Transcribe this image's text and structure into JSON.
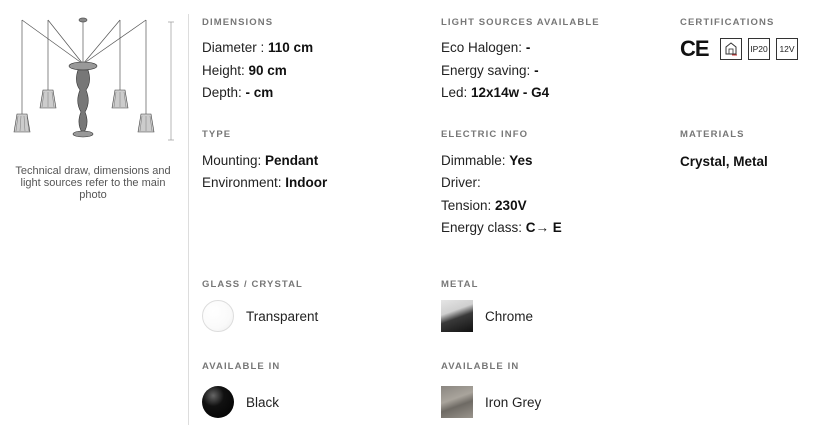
{
  "left": {
    "caption": "Technical draw, dimensions and light sources refer to the main photo"
  },
  "dimensions": {
    "title": "DIMENSIONS",
    "diameter_label": "Diameter : ",
    "diameter_value": "110 cm",
    "height_label": "Height: ",
    "height_value": "90 cm",
    "depth_label": "Depth: ",
    "depth_value": "- cm"
  },
  "light_sources": {
    "title": "LIGHT SOURCES AVAILABLE",
    "eco_label": "Eco Halogen: ",
    "eco_value": "-",
    "saving_label": "Energy saving: ",
    "saving_value": "-",
    "led_label": "Led: ",
    "led_value": "12x14w - G4"
  },
  "certifications": {
    "title": "CERTIFICATIONS",
    "items": [
      "CE",
      "class-ii-icon",
      "IP20",
      "12V"
    ]
  },
  "type": {
    "title": "TYPE",
    "mounting_label": "Mounting: ",
    "mounting_value": "Pendant",
    "environment_label": "Environment: ",
    "environment_value": "Indoor"
  },
  "electric": {
    "title": "ELECTRIC INFO",
    "dimmable_label": "Dimmable: ",
    "dimmable_value": "Yes",
    "driver_label": "Driver:",
    "tension_label": "Tension: ",
    "tension_value": "230V",
    "class_label": "Energy class: ",
    "class_value": "C→ E"
  },
  "materials": {
    "title": "MATERIALS",
    "value": "Crystal, Metal"
  },
  "glass": {
    "title": "GLASS / CRYSTAL",
    "swatch_label": "Transparent"
  },
  "metal": {
    "title": "METAL",
    "swatch_label": "Chrome"
  },
  "available_glass": {
    "title": "AVAILABLE IN",
    "swatch_label": "Black"
  },
  "available_metal": {
    "title": "AVAILABLE IN",
    "swatch_label": "Iron Grey"
  }
}
